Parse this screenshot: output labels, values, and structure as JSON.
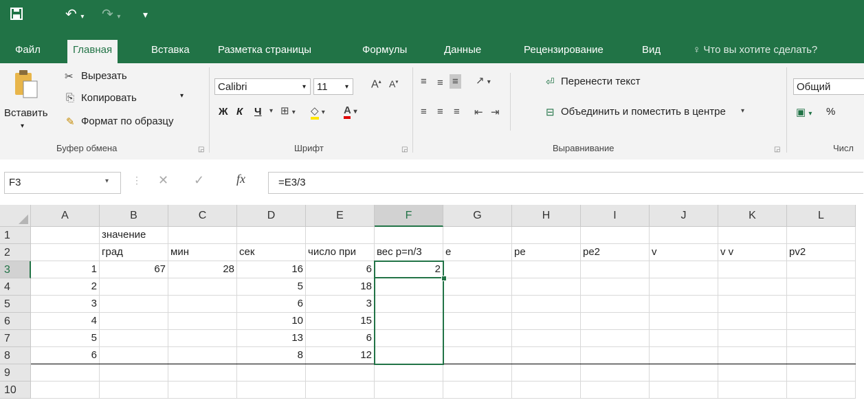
{
  "ribbon": {
    "tabs": [
      "Файл",
      "Главная",
      "Вставка",
      "Разметка страницы",
      "Формулы",
      "Данные",
      "Рецензирование",
      "Вид"
    ],
    "tell_me": "Что вы хотите сделать?",
    "clipboard": {
      "paste": "Вставить",
      "cut": "Вырезать",
      "copy": "Копировать",
      "format_painter": "Формат по образцу",
      "label": "Буфер обмена"
    },
    "font": {
      "name": "Calibri",
      "size": "11",
      "bold": "Ж",
      "italic": "К",
      "underline": "Ч",
      "label": "Шрифт"
    },
    "alignment": {
      "wrap_text": "Перенести текст",
      "merge_center": "Объединить и поместить в центре",
      "label": "Выравнивание"
    },
    "number": {
      "format": "Общий",
      "percent": "%",
      "label": "Числ"
    }
  },
  "formula_bar": {
    "name_box": "F3",
    "fx": "fx",
    "formula": "=E3/3"
  },
  "sheet": {
    "columns": [
      "A",
      "B",
      "C",
      "D",
      "E",
      "F",
      "G",
      "H",
      "I",
      "J",
      "K",
      "L"
    ],
    "rows": [
      "1",
      "2",
      "3",
      "4",
      "5",
      "6",
      "7",
      "8",
      "9",
      "10"
    ],
    "selected_cell": "F3",
    "cells": [
      [
        "",
        "значение",
        "",
        "",
        "",
        "",
        "",
        "",
        "",
        "",
        "",
        ""
      ],
      [
        "",
        "град",
        "мин",
        "сек",
        "число при",
        "вес p=n/3",
        "e",
        "pe",
        "pe2",
        "v",
        "v v",
        "pv2"
      ],
      [
        "1",
        "67",
        "28",
        "16",
        "6",
        "2",
        "",
        "",
        "",
        "",
        "",
        ""
      ],
      [
        "2",
        "",
        "",
        "5",
        "18",
        "",
        "",
        "",
        "",
        "",
        "",
        ""
      ],
      [
        "3",
        "",
        "",
        "6",
        "3",
        "",
        "",
        "",
        "",
        "",
        "",
        ""
      ],
      [
        "4",
        "",
        "",
        "10",
        "15",
        "",
        "",
        "",
        "",
        "",
        "",
        ""
      ],
      [
        "5",
        "",
        "",
        "13",
        "6",
        "",
        "",
        "",
        "",
        "",
        "",
        ""
      ],
      [
        "6",
        "",
        "",
        "8",
        "12",
        "",
        "",
        "",
        "",
        "",
        "",
        ""
      ],
      [
        "",
        "",
        "",
        "",
        "",
        "",
        "",
        "",
        "",
        "",
        "",
        ""
      ],
      [
        "",
        "",
        "",
        "",
        "",
        "",
        "",
        "",
        "",
        "",
        "",
        ""
      ]
    ]
  },
  "colors": {
    "accent": "#217346"
  }
}
